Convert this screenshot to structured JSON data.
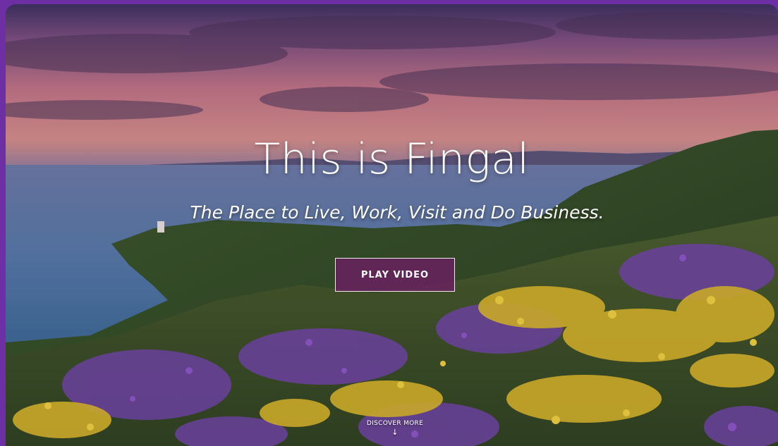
{
  "hero": {
    "title": "This is Fingal",
    "subtitle": "The Place to Live, Work, Visit and Do Business.",
    "play_button_label": "PLAY VIDEO",
    "discover_label": "DISCOVER MORE",
    "discover_arrow": "↓"
  },
  "colors": {
    "frame": "#6d2fa3",
    "button_bg": "#6e1e64",
    "text": "#ffffff"
  },
  "icons": {
    "discover_arrow": "arrow-down-icon"
  }
}
